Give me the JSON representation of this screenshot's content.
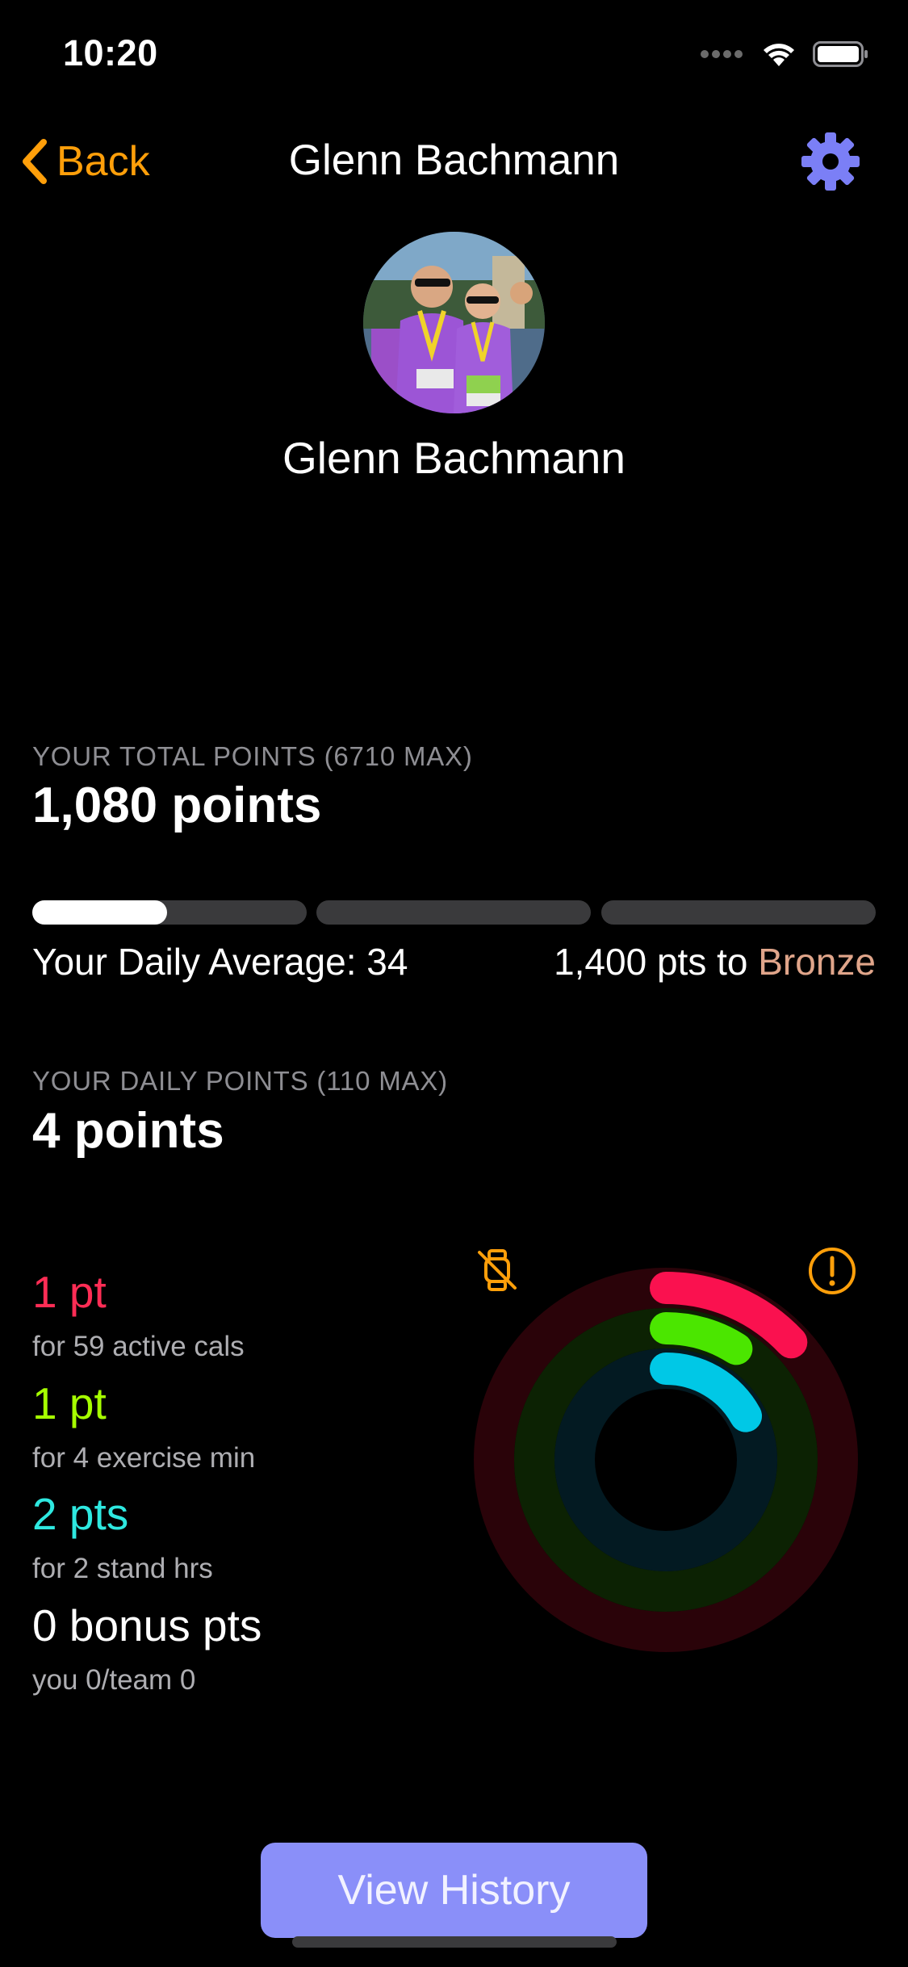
{
  "status_bar": {
    "time": "10:20"
  },
  "nav": {
    "back_label": "Back",
    "title": "Glenn Bachmann",
    "accent_color": "#ff9f0a",
    "settings_color": "#7b7ff6"
  },
  "profile": {
    "name": "Glenn Bachmann"
  },
  "total_points": {
    "label": "YOUR TOTAL POINTS (6710 MAX)",
    "value": "1,080 points",
    "progress_fraction": 0.16,
    "daily_average": "Your Daily Average: 34",
    "to_next_prefix": "1,400 pts to ",
    "next_level": "Bronze",
    "next_level_color": "#e0a58a"
  },
  "daily_points": {
    "label": "YOUR DAILY POINTS (110 MAX)",
    "value": "4 points"
  },
  "breakdown": [
    {
      "value": "1 pt",
      "desc": "for 59 active cals",
      "color": "#ff2d55"
    },
    {
      "value": "1 pt",
      "desc": "for 4 exercise min",
      "color": "#a6ff00"
    },
    {
      "value": "2 pts",
      "desc": "for 2 stand hrs",
      "color": "#2ee8e0"
    },
    {
      "value": "0 bonus pts",
      "desc": "you 0/team 0",
      "color": "#ffffff"
    }
  ],
  "rings": {
    "move": {
      "fraction": 0.13,
      "color": "#fa114f",
      "track": "#2a0309"
    },
    "exercise": {
      "fraction": 0.09,
      "color": "#4be600",
      "track": "#0c2203"
    },
    "stand": {
      "fraction": 0.17,
      "color": "#00c8e6",
      "track": "#031a22"
    }
  },
  "history_button_label": "View History",
  "history_button_color": "#8a8ff9"
}
